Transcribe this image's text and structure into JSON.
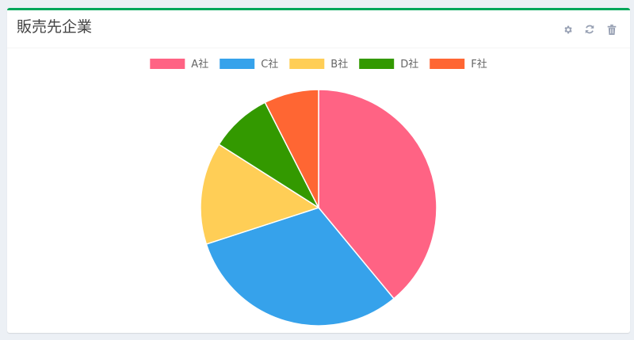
{
  "panel": {
    "title": "販売先企業",
    "accent_color": "#00a65a"
  },
  "tools": [
    {
      "icon": "gear-icon",
      "name": "settings-button"
    },
    {
      "icon": "refresh-icon",
      "name": "refresh-button"
    },
    {
      "icon": "trash-icon",
      "name": "delete-button"
    }
  ],
  "chart_data": {
    "type": "pie",
    "title": "",
    "legend_position": "top",
    "slices": [
      {
        "label": "A社",
        "value": 39,
        "color": "#ff6384"
      },
      {
        "label": "C社",
        "value": 31,
        "color": "#36a2eb"
      },
      {
        "label": "B社",
        "value": 14,
        "color": "#ffce56"
      },
      {
        "label": "D社",
        "value": 8.5,
        "color": "#339900"
      },
      {
        "label": "F社",
        "value": 7.5,
        "color": "#ff6633"
      }
    ]
  }
}
